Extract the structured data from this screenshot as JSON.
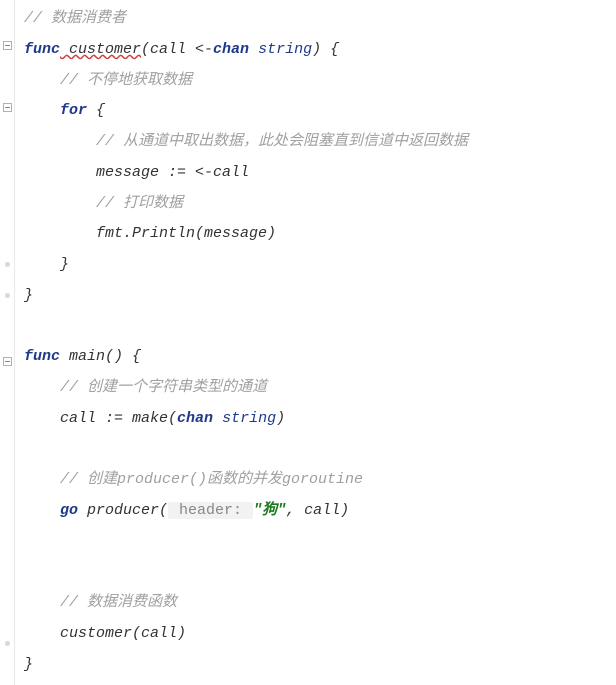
{
  "lines": {
    "c_consumer": "// 数据消费者",
    "func_customer_1": "func",
    "func_customer_name": " customer",
    "func_customer_sig_1": "(call <-",
    "func_customer_chan": "chan",
    "func_customer_sig_2": " string",
    "func_customer_sig_3": ") {",
    "c_loop": "// 不停地获取数据",
    "for_kw": "for",
    "for_brace": " {",
    "c_receive": "// 从通道中取出数据，此处会阻塞直到信道中返回数据",
    "recv_stmt": "message := <-call",
    "c_print": "// 打印数据",
    "print_stmt": "fmt.Println(message)",
    "close1": "}",
    "close2": "}",
    "func_main_kw": "func",
    "func_main_sig": " main() {",
    "c_make": "// 创建一个字符串类型的通道",
    "make_1": "call := make(",
    "make_chan": "chan",
    "make_2": " string",
    "make_3": ")",
    "c_goroutine": "// 创建producer()函数的并发goroutine",
    "go_kw": "go",
    "go_call_1": " producer(",
    "go_hint": " header: ",
    "go_str": "\"狗\"",
    "go_call_2": ", call)",
    "c_consume_call": "// 数据消费函数",
    "consume_call": "customer(call)",
    "close3": "}"
  }
}
